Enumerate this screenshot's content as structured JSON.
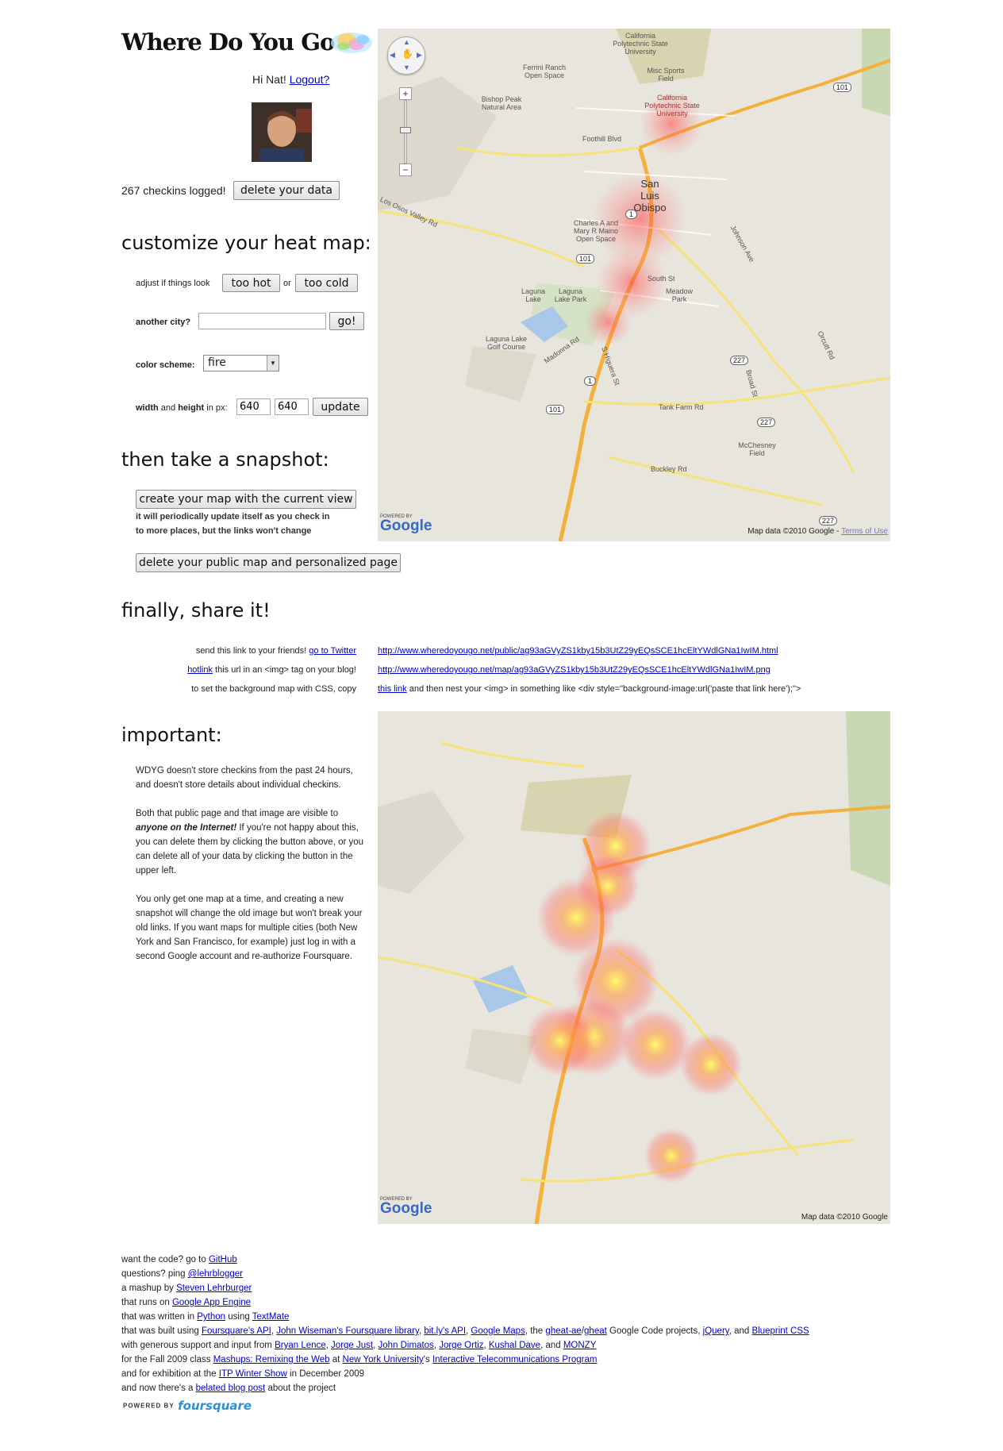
{
  "header": {
    "logo_text": "Where Do You Go",
    "greeting": "Hi Nat!",
    "logout_label": "Logout?"
  },
  "account": {
    "checkins_text": "267 checkins logged!",
    "delete_data_label": "delete your data"
  },
  "customize": {
    "heading": "customize your heat map:",
    "adjust_label": "adjust if things look",
    "too_hot_label": "too hot",
    "or_label": "or",
    "too_cold_label": "too cold",
    "city_label": "another city?",
    "city_value": "",
    "go_label": "go!",
    "color_label": "color scheme",
    "color_value": "fire",
    "size_label_width": "width",
    "size_label_and": "and",
    "size_label_height": "height",
    "size_label_px": "in px:",
    "width_value": "640",
    "height_value": "640",
    "update_label": "update"
  },
  "snapshot": {
    "heading": "then take a snapshot:",
    "create_label": "create your map with the current view",
    "note_line1": "it will periodically update itself as you check in",
    "note_line2": "to more places, but the links won't change",
    "delete_label": "delete your public map and personalized page"
  },
  "share": {
    "heading": "finally, share it!",
    "row1_prefix": "send this link to your friends!",
    "row1_link": "go to Twitter",
    "row1_url": "http://www.wheredoyougo.net/public/ag93aGVyZS1kby15b3UtZ29yEQsSCE1hcEltYWdlGNa1IwIM.html",
    "row2_link": "hotlink",
    "row2_suffix": "this url in an <img> tag on your blog!",
    "row2_url": "http://www.wheredoyougo.net/map/ag93aGVyZS1kby15b3UtZ29yEQsSCE1hcEltYWdlGNa1IwIM.png",
    "row3_prefix": "to set the background map with CSS, copy",
    "row3_link": "this link",
    "row3_suffix": "and then nest your <img> in something like <div style=\"background-image:url('paste that link here');\">"
  },
  "important": {
    "heading": "important:",
    "p1": "WDYG doesn't store checkins from the past 24 hours, and doesn't store details about individual checkins.",
    "p2_a": "Both that public page and that image are visible to",
    "p2_b": "anyone on the Internet!",
    "p2_c": "If you're not happy about this, you can delete them by clicking the button above, or you can delete all of your data by clicking the button in the upper left.",
    "p3": "You only get one map at a time, and creating a new snapshot will change the old image but won't break your old links. If you want maps for multiple cities (both New York and San Francisco, for example) just log in with a second Google account and re-authorize Foursquare."
  },
  "map_top": {
    "attribution": "Map data ©2010 Google -",
    "terms_label": "Terms of Use",
    "powered_by": "POWERED BY",
    "google": "Google",
    "labels": {
      "cal_poly_state": "California Polytechnic State University",
      "ferrini": "Ferrini Ranch Open Space",
      "misc_sports": "Misc Sports Field",
      "cal_poly": "California Polytechnic State University",
      "bishop_peak": "Bishop Peak Natural Area",
      "san_luis": "San Luis Obispo",
      "charles": "Charles A and Mary R Maino Open Space",
      "laguna_lake": "Laguna Lake",
      "laguna_lake_park": "Laguna Lake Park",
      "south_st": "South St",
      "meadow_park": "Meadow Park",
      "laguna_golf": "Laguna Lake Golf Course",
      "mcchesney": "McChesney Field",
      "tank_farm": "Tank Farm Rd",
      "buckley": "Buckley Rd",
      "foothill": "Foothill Blvd",
      "madonna": "Madonna Rd",
      "higuera": "S Higuera St",
      "broad": "Broad St",
      "orcutt": "Orcutt Rd",
      "johnson": "Johnson Ave",
      "los_osos": "Los Osos Valley Rd",
      "shield_101": "101",
      "shield_1": "1",
      "shield_227": "227"
    }
  },
  "map_bottom": {
    "attribution": "Map data ©2010 Google",
    "powered_by": "POWERED BY",
    "google": "Google"
  },
  "footer": {
    "l1_text": "want the code? go to",
    "l1_link": "GitHub",
    "l2_text": "questions? ping",
    "l2_link": "@lehrblogger",
    "l3_text": "a mashup by",
    "l3_link": "Steven Lehrburger",
    "l4_text": "that runs on",
    "l4_link": "Google App Engine",
    "l5_text": "that was written in",
    "l5_link1": "Python",
    "l5_mid": "using",
    "l5_link2": "TextMate",
    "l6_text": "that was built using",
    "l6_link1": "Foursquare's API",
    "l6_link2": "John Wiseman's Foursquare library",
    "l6_link3": "bit.ly's API",
    "l6_link4": "Google Maps",
    "l6_the": "the",
    "l6_link5": "gheat-ae",
    "l6_link6": "gheat",
    "l6_gc": "Google Code projects,",
    "l6_link7": "jQuery",
    "l6_and": "and",
    "l6_link8": "Blueprint CSS",
    "l7_text": "with generous support and input from",
    "l7_link1": "Bryan Lence",
    "l7_link2": "Jorge Just",
    "l7_link3": "John Dimatos",
    "l7_link4": "Jorge Ortiz",
    "l7_link5": "Kushal Dave",
    "l7_and": "and",
    "l7_link6": "MONZY",
    "l8_text": "for the Fall 2009 class",
    "l8_link1": "Mashups: Remixing the Web",
    "l8_at": "at",
    "l8_link2": "New York University",
    "l8_s": "'s",
    "l8_link3": "Interactive Telecommunications Program",
    "l9_text": "and for exhibition at the",
    "l9_link": "ITP Winter Show",
    "l9_suffix": "in December 2009",
    "l10_text": "and now there's a",
    "l10_link": "belated blog post",
    "l10_suffix": "about the project",
    "powered_by": "POWERED BY",
    "foursquare": "foursquare"
  }
}
